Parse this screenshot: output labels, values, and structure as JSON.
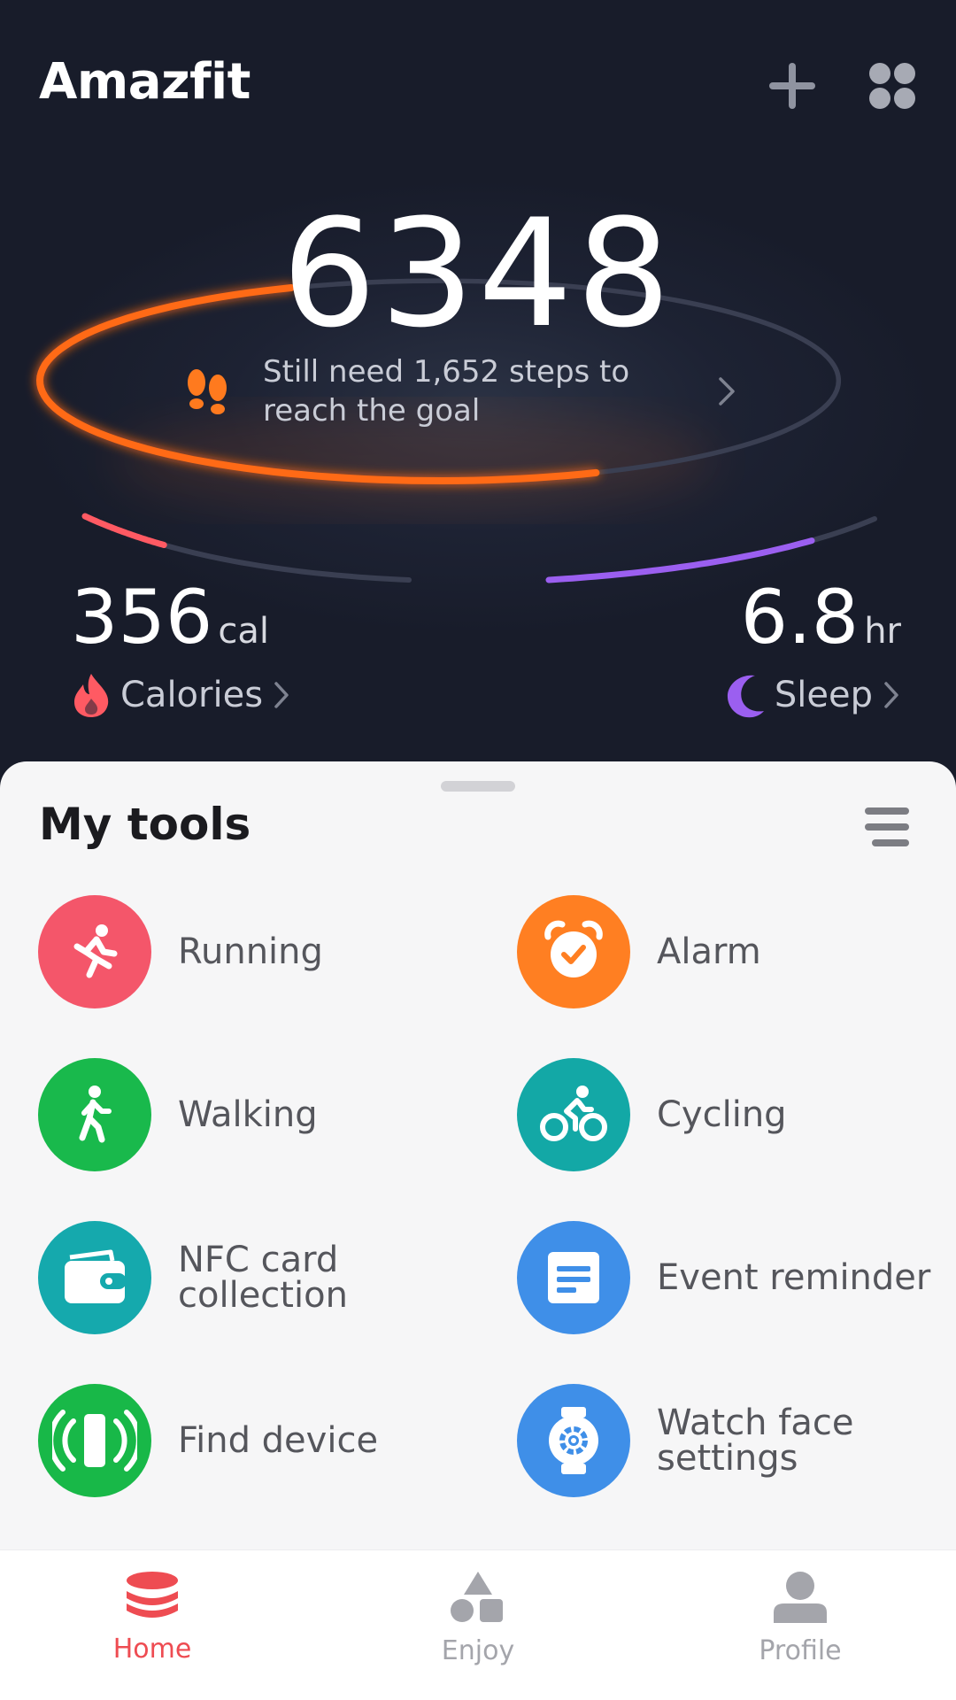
{
  "app": {
    "title": "Amazfit"
  },
  "header": {
    "add_icon": "plus-icon",
    "apps_icon": "grid-icon"
  },
  "steps": {
    "value": "6348",
    "goal_message": "Still need 1,652 steps to reach the goal",
    "progress": 0.7,
    "ring_color": "#ff6a14"
  },
  "calories": {
    "value": "356",
    "unit": "cal",
    "label": "Calories",
    "color": "#ff5a63",
    "progress": 0.3
  },
  "sleep": {
    "value": "6.8",
    "unit": "hr",
    "label": "Sleep",
    "color": "#9b5ff0",
    "progress": 0.75
  },
  "tools": {
    "title": "My tools",
    "items": [
      {
        "label": "Running",
        "icon": "running-icon",
        "color": "#f4566a"
      },
      {
        "label": "Alarm",
        "icon": "alarm-icon",
        "color": "#ff7f22"
      },
      {
        "label": "Walking",
        "icon": "walking-icon",
        "color": "#19b94c"
      },
      {
        "label": "Cycling",
        "icon": "cycling-icon",
        "color": "#13a8a6"
      },
      {
        "label": "NFC card collection",
        "icon": "wallet-icon",
        "color": "#15a9ad"
      },
      {
        "label": "Event reminder",
        "icon": "reminder-icon",
        "color": "#3f8fe8"
      },
      {
        "label": "Find device",
        "icon": "vibrate-phone-icon",
        "color": "#18b848"
      },
      {
        "label": "Watch face settings",
        "icon": "watch-gear-icon",
        "color": "#3f8fe8"
      }
    ]
  },
  "nav": {
    "items": [
      {
        "label": "Home",
        "icon": "home-stack-icon",
        "active": true
      },
      {
        "label": "Enjoy",
        "icon": "shapes-icon",
        "active": false
      },
      {
        "label": "Profile",
        "icon": "person-icon",
        "active": false
      }
    ],
    "active_color": "#ee4c52",
    "inactive_color": "#a4a5ab"
  }
}
